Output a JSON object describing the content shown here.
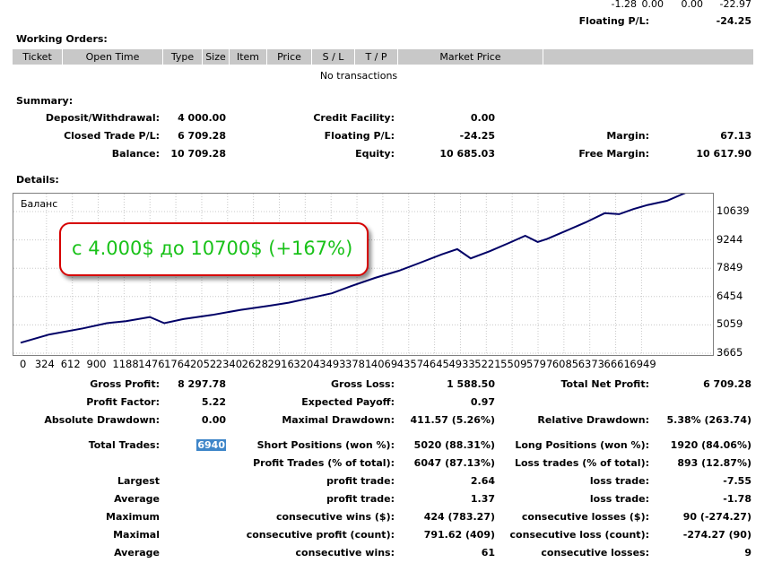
{
  "top": {
    "cells": [
      "-1.28",
      "0.00",
      "0.00",
      "-22.97"
    ],
    "floating_label": "Floating P/L:",
    "floating_value": "-24.25"
  },
  "working_orders": {
    "title": "Working Orders:",
    "columns": [
      "Ticket",
      "Open Time",
      "Type",
      "Size",
      "Item",
      "Price",
      "S / L",
      "T / P",
      "Market Price"
    ],
    "empty_text": "No transactions"
  },
  "summary": {
    "title": "Summary:",
    "rows": [
      [
        {
          "l": "Deposit/Withdrawal:",
          "v": "4 000.00"
        },
        {
          "l": "Credit Facility:",
          "v": "0.00"
        },
        {
          "l": "",
          "v": ""
        }
      ],
      [
        {
          "l": "Closed Trade P/L:",
          "v": "6 709.28"
        },
        {
          "l": "Floating P/L:",
          "v": "-24.25"
        },
        {
          "l": "Margin:",
          "v": "67.13"
        }
      ],
      [
        {
          "l": "Balance:",
          "v": "10 709.28"
        },
        {
          "l": "Equity:",
          "v": "10 685.03"
        },
        {
          "l": "Free Margin:",
          "v": "10 617.90"
        }
      ]
    ]
  },
  "details": {
    "title": "Details:"
  },
  "chart_data": {
    "type": "line",
    "title": "Баланс",
    "xlabel": "",
    "ylabel": "",
    "x_ticks": [
      "0",
      "324",
      "612",
      "900",
      "1188",
      "1476",
      "1764",
      "2052",
      "2340",
      "2628",
      "2916",
      "3204",
      "3493",
      "3781",
      "4069",
      "4357",
      "4645",
      "4933",
      "5221",
      "5509",
      "5797",
      "6085",
      "6373",
      "6661",
      "6949"
    ],
    "y_ticks": [
      "10639",
      "9244",
      "7849",
      "6454",
      "5059",
      "3665"
    ],
    "xlim": [
      0,
      7230
    ],
    "ylim": [
      3665,
      10900
    ],
    "grid": true,
    "series": [
      {
        "color": "#000066",
        "x": [
          0,
          300,
          650,
          900,
          1100,
          1350,
          1500,
          1700,
          2000,
          2300,
          2600,
          2800,
          3050,
          3250,
          3450,
          3700,
          3950,
          4150,
          4400,
          4560,
          4700,
          4900,
          5100,
          5270,
          5400,
          5500,
          5700,
          5900,
          6100,
          6250,
          6400,
          6550,
          6750,
          6950,
          7100,
          7230
        ],
        "y": [
          4000,
          4400,
          4700,
          4950,
          5050,
          5250,
          4950,
          5150,
          5350,
          5600,
          5800,
          5950,
          6200,
          6400,
          6750,
          7150,
          7500,
          7850,
          8300,
          8550,
          8100,
          8450,
          8850,
          9200,
          8900,
          9050,
          9450,
          9850,
          10300,
          10250,
          10500,
          10700,
          10900,
          11300,
          11600,
          11900
        ]
      }
    ]
  },
  "callout": {
    "text": "с 4.000$ до 10700$ (+167%)",
    "border_color": "#d60000",
    "text_color": "#19c219"
  },
  "stats": {
    "gross_profit": {
      "l": "Gross Profit:",
      "v": "8 297.78"
    },
    "gross_loss": {
      "l": "Gross Loss:",
      "v": "1 588.50"
    },
    "total_net_profit": {
      "l": "Total Net Profit:",
      "v": "6 709.28"
    },
    "profit_factor": {
      "l": "Profit Factor:",
      "v": "5.22"
    },
    "expected_payoff": {
      "l": "Expected Payoff:",
      "v": "0.97"
    },
    "absolute_drawdown": {
      "l": "Absolute Drawdown:",
      "v": "0.00"
    },
    "maximal_drawdown": {
      "l": "Maximal Drawdown:",
      "v": "411.57 (5.26%)"
    },
    "relative_drawdown": {
      "l": "Relative Drawdown:",
      "v": "5.38% (263.74)"
    },
    "total_trades": {
      "l": "Total Trades:",
      "v": "6940"
    },
    "short_positions": {
      "l": "Short Positions (won %):",
      "v": "5020 (88.31%)"
    },
    "long_positions": {
      "l": "Long Positions (won %):",
      "v": "1920 (84.06%)"
    },
    "profit_trades": {
      "l": "Profit Trades (% of total):",
      "v": "6047 (87.13%)"
    },
    "loss_trades": {
      "l": "Loss trades (% of total):",
      "v": "893 (12.87%)"
    },
    "largest": {
      "l": "Largest",
      "pl": "profit trade:",
      "pv": "2.64",
      "ll": "loss trade:",
      "lv": "-7.55"
    },
    "average": {
      "l": "Average",
      "pl": "profit trade:",
      "pv": "1.37",
      "ll": "loss trade:",
      "lv": "-1.78"
    },
    "maximum": {
      "l": "Maximum",
      "pl": "consecutive wins ($):",
      "pv": "424 (783.27)",
      "ll": "consecutive losses ($):",
      "lv": "90 (-274.27)"
    },
    "maximal": {
      "l": "Maximal",
      "pl": "consecutive profit (count):",
      "pv": "791.62 (409)",
      "ll": "consecutive loss (count):",
      "lv": "-274.27 (90)"
    },
    "average2": {
      "l": "Average",
      "pl": "consecutive wins:",
      "pv": "61",
      "ll": "consecutive losses:",
      "lv": "9"
    }
  }
}
